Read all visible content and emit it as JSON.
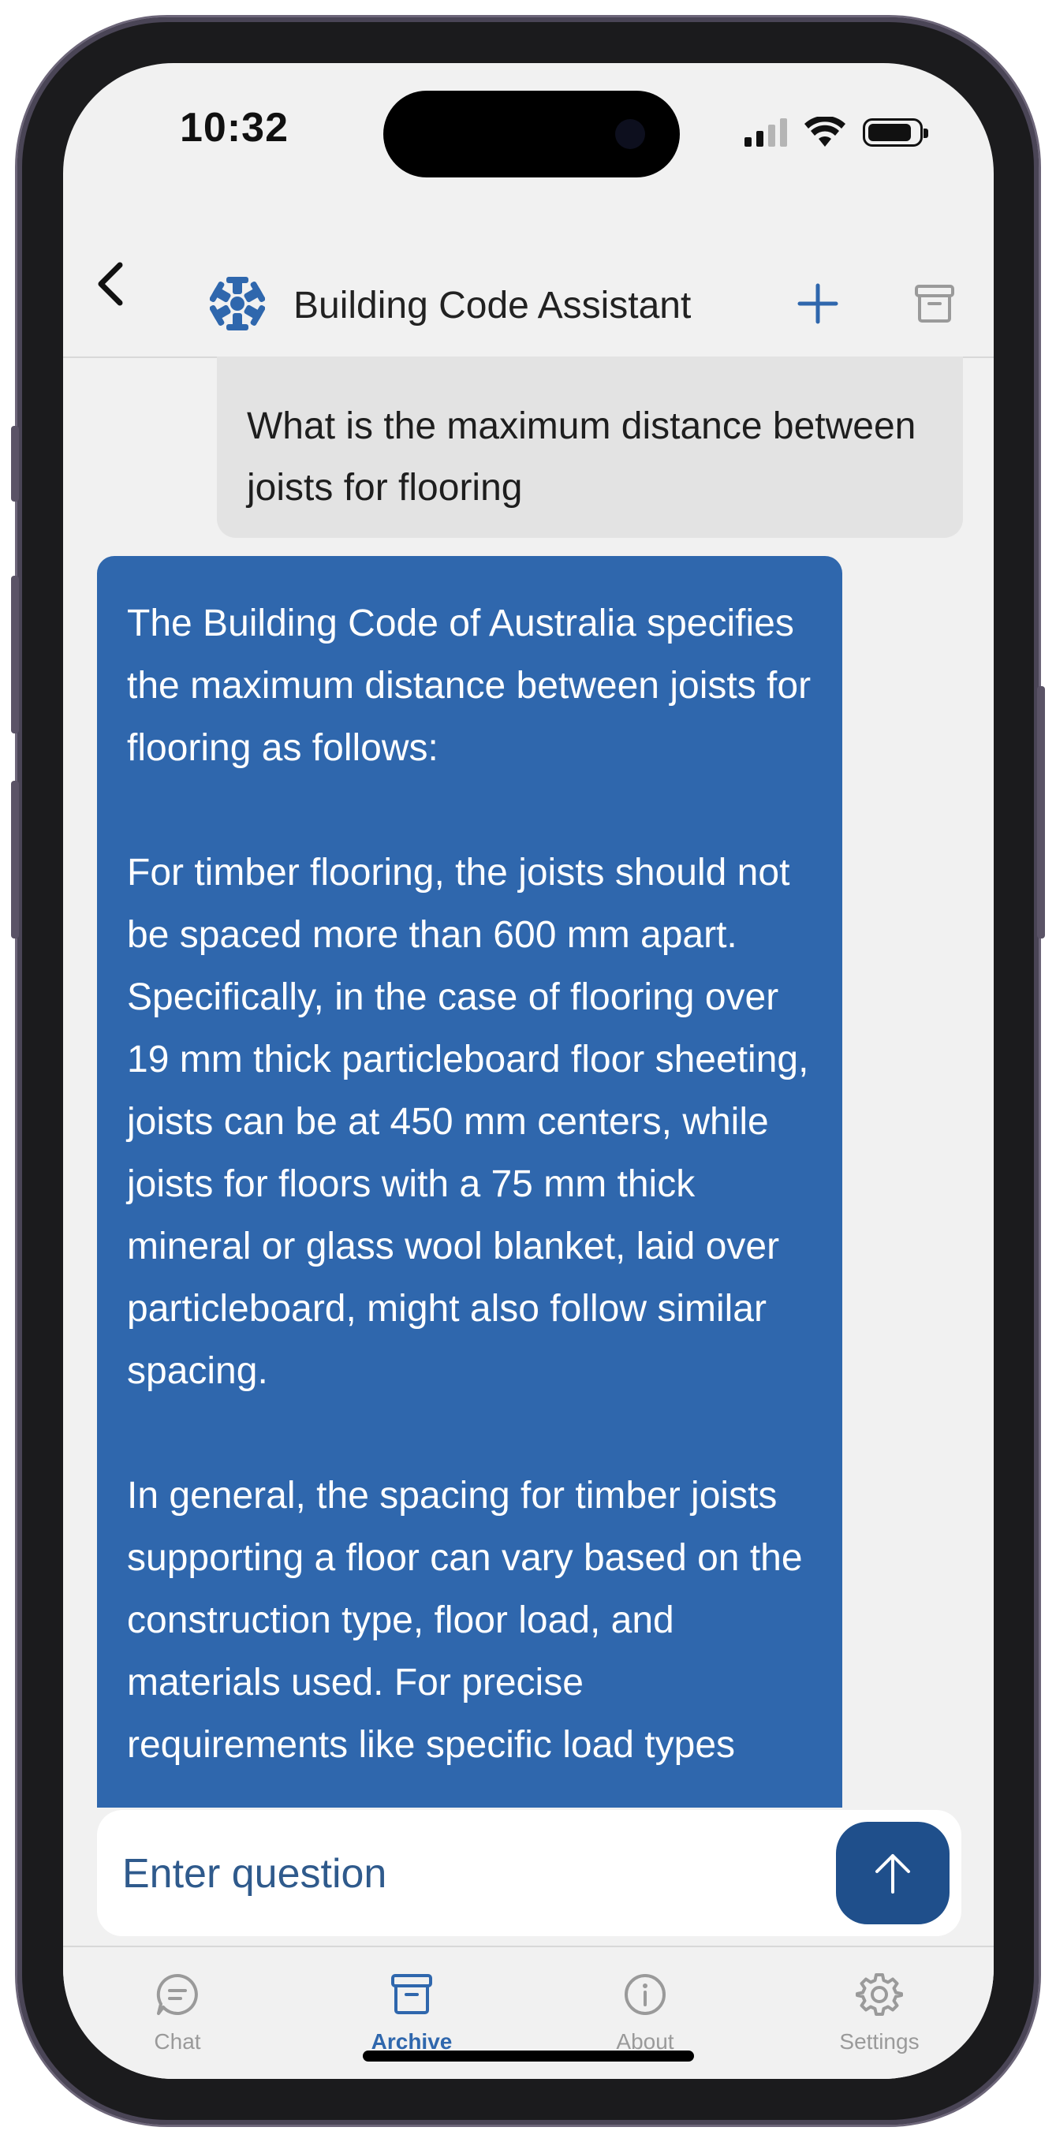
{
  "status_bar": {
    "time": "10:32"
  },
  "header": {
    "title": "Building Code Assistant",
    "back_icon": "chevron-left-icon",
    "new_chat_icon": "plus-icon",
    "archive_icon": "archive-box-icon",
    "logo_icon": "snowflake-logo-icon"
  },
  "conversation": {
    "user_message": "What is the maximum distance between joists for flooring",
    "assistant_paragraphs": [
      "The Building Code of Australia specifies the maximum distance between joists for flooring as follows:",
      "For timber flooring, the joists should not be spaced more than 600 mm apart. Specifically, in the case of flooring over 19 mm thick particleboard floor sheeting, joists can be at 450 mm centers, while joists for floors with a 75 mm thick mineral or glass wool blanket, laid over particleboard, might also follow similar spacing.",
      "In general, the spacing for timber joists supporting a floor can vary based on the construction type, floor load, and materials used. For precise requirements like specific load types"
    ]
  },
  "composer": {
    "placeholder": "Enter question",
    "send_icon": "arrow-up-icon"
  },
  "tabs": [
    {
      "label": "Chat",
      "icon": "chat-bubble-icon",
      "active": false
    },
    {
      "label": "Archive",
      "icon": "archive-box-icon",
      "active": true
    },
    {
      "label": "About",
      "icon": "info-circle-icon",
      "active": false
    },
    {
      "label": "Settings",
      "icon": "gear-icon",
      "active": false
    }
  ],
  "colors": {
    "accent": "#2f67ad",
    "send_button": "#1f4f8b",
    "user_bubble": "#e3e3e3",
    "inactive_tab": "#9a9a9a"
  }
}
